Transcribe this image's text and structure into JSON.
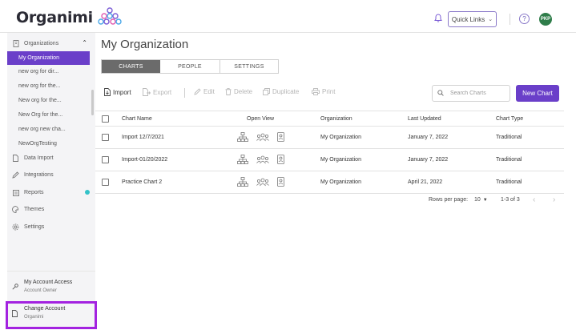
{
  "brand": {
    "name": "Organimi"
  },
  "header": {
    "quick_links_label": "Quick Links",
    "help_label": "?",
    "avatar_initials": "PKP",
    "icons": [
      "bell-icon",
      "chevron-down-icon",
      "help-icon"
    ]
  },
  "sidebar": {
    "organizations_label": "Organizations",
    "orgs": [
      "My Organization",
      "new org for dir...",
      "new org for the...",
      "New org for the...",
      "New Org for the...",
      "new org new cha...",
      "NewOrgTesting"
    ],
    "nav": [
      {
        "label": "Data Import",
        "icon": "document-icon"
      },
      {
        "label": "Integrations",
        "icon": "pencil-icon"
      },
      {
        "label": "Reports",
        "icon": "report-icon"
      },
      {
        "label": "Themes",
        "icon": "palette-icon"
      },
      {
        "label": "Settings",
        "icon": "gear-icon"
      }
    ],
    "account_access": {
      "title": "My Account Access",
      "subtitle": "Account Owner"
    },
    "change_account": {
      "title": "Change Account",
      "subtitle": "Organimi"
    }
  },
  "main": {
    "title": "My Organization",
    "tabs": [
      "CHARTS",
      "PEOPLE",
      "SETTINGS"
    ],
    "active_tab": "CHARTS",
    "toolbar": {
      "import": "Import",
      "export": "Export",
      "edit": "Edit",
      "delete": "Delete",
      "duplicate": "Duplicate",
      "print": "Print"
    },
    "search_placeholder": "Search Charts",
    "new_chart_label": "New Chart",
    "columns": [
      "Chart Name",
      "Open View",
      "Organization",
      "Last Updated",
      "Chart Type"
    ],
    "rows": [
      {
        "name": "Import 12/7/2021",
        "organization": "My Organization",
        "updated": "January 7, 2022",
        "type": "Traditional"
      },
      {
        "name": "Import-01/20/2022",
        "organization": "My Organization",
        "updated": "January 7, 2022",
        "type": "Traditional"
      },
      {
        "name": "Practice Chart 2",
        "organization": "My Organization",
        "updated": "April 21, 2022",
        "type": "Traditional"
      }
    ],
    "pagination": {
      "rows_per_page_label": "Rows per page:",
      "rows_per_page": "10",
      "range": "1-3 of 3"
    }
  },
  "colors": {
    "accent": "#6a3fc9",
    "highlight_border": "#a322e0",
    "status_dot": "#33c2c8",
    "avatar_bg": "#2f7d4a"
  }
}
